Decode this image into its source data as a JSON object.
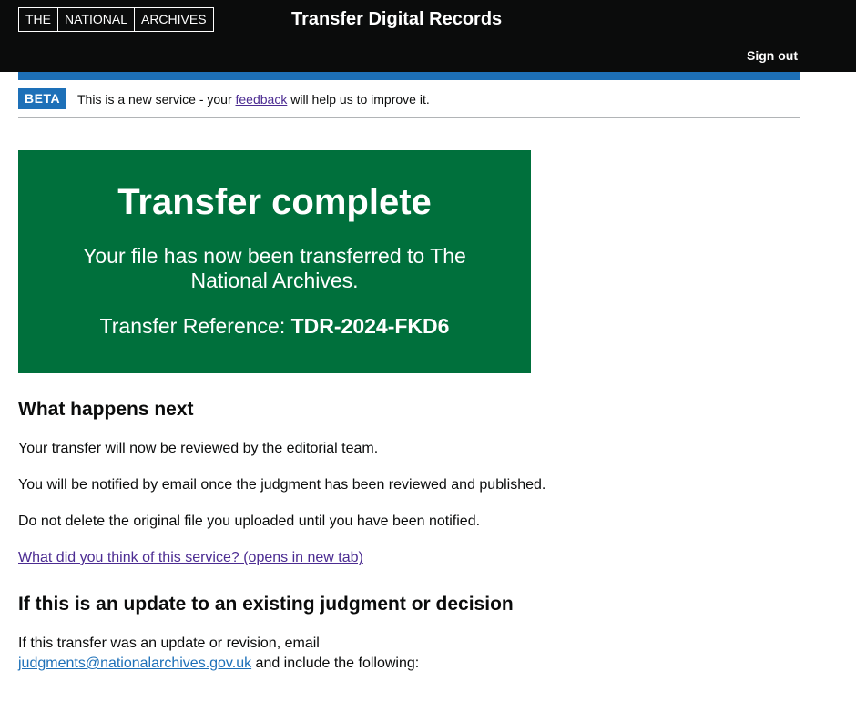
{
  "header": {
    "logo_parts": [
      "THE",
      "NATIONAL",
      "ARCHIVES"
    ],
    "service_name": "Transfer Digital Records",
    "sign_out_label": "Sign out"
  },
  "phase_banner": {
    "tag": "BETA",
    "text_before": "This is a new service - your ",
    "link_text": "feedback",
    "text_after": " will help us to improve it."
  },
  "panel": {
    "title": "Transfer complete",
    "body": "Your file has now been transferred to The National Archives.",
    "reference_label": "Transfer Reference: ",
    "reference_value": "TDR-2024-FKD6"
  },
  "next_steps": {
    "heading": "What happens next",
    "paragraphs": [
      "Your transfer will now be reviewed by the editorial team.",
      "You will be notified by email once the judgment has been reviewed and published.",
      "Do not delete the original file you uploaded until you have been notified."
    ],
    "survey_link": "What did you think of this service? (opens in new tab)"
  },
  "update": {
    "heading": "If this is an update to an existing judgment or decision",
    "text_before": "If this transfer was an update or revision, email ",
    "email": "judgments@nationalarchives.gov.uk",
    "text_after": " and include the following:"
  },
  "colors": {
    "header_bg": "#0b0c0c",
    "brand_blue": "#1d70b8",
    "panel_green": "#00703c",
    "visited_link": "#4c2c92"
  }
}
